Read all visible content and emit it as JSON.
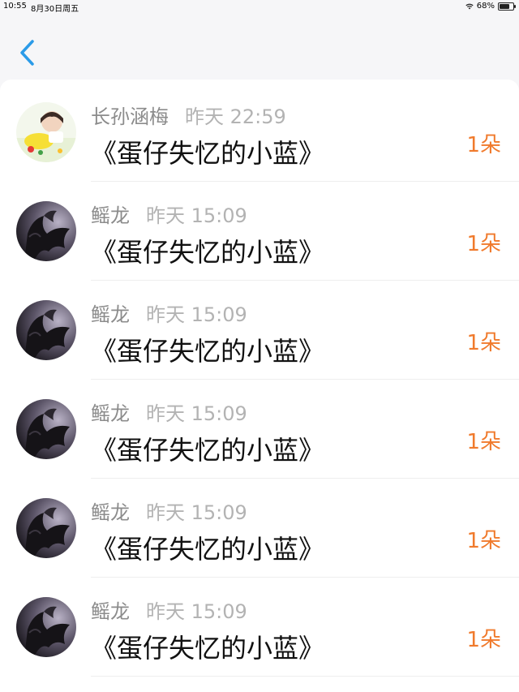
{
  "status_bar": {
    "time": "10:55",
    "date": "8月30日周五",
    "battery": "68%"
  },
  "colors": {
    "accent": "#2b9be8",
    "count": "#f07a2c"
  },
  "items": [
    {
      "name": "长孙涵梅",
      "time": "昨天 22:59",
      "message": "《蛋仔失忆的小蓝》",
      "count": "1朵",
      "avatar": "person-avatar"
    },
    {
      "name": "鳐龙",
      "time": "昨天 15:09",
      "message": "《蛋仔失忆的小蓝》",
      "count": "1朵",
      "avatar": "dragon-avatar"
    },
    {
      "name": "鳐龙",
      "time": "昨天 15:09",
      "message": "《蛋仔失忆的小蓝》",
      "count": "1朵",
      "avatar": "dragon-avatar"
    },
    {
      "name": "鳐龙",
      "time": "昨天 15:09",
      "message": "《蛋仔失忆的小蓝》",
      "count": "1朵",
      "avatar": "dragon-avatar"
    },
    {
      "name": "鳐龙",
      "time": "昨天 15:09",
      "message": "《蛋仔失忆的小蓝》",
      "count": "1朵",
      "avatar": "dragon-avatar"
    },
    {
      "name": "鳐龙",
      "time": "昨天 15:09",
      "message": "《蛋仔失忆的小蓝》",
      "count": "1朵",
      "avatar": "dragon-avatar"
    }
  ]
}
